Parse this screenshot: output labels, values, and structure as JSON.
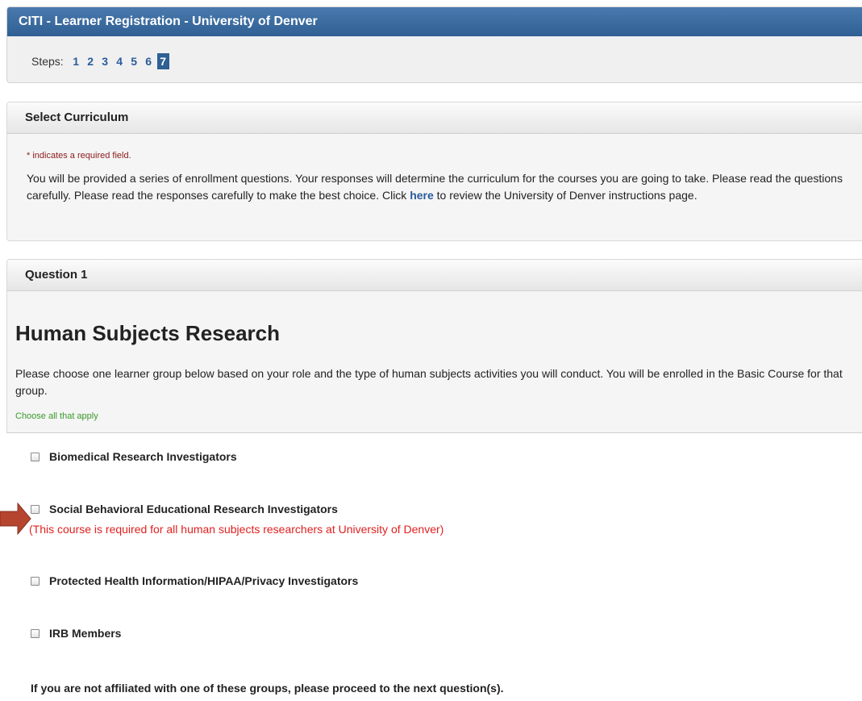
{
  "header": {
    "title": "CITI - Learner Registration - University of Denver",
    "steps_label": "Steps:",
    "steps": [
      "1",
      "2",
      "3",
      "4",
      "5",
      "6",
      "7"
    ],
    "active_step": "7"
  },
  "curriculum": {
    "heading": "Select Curriculum",
    "required_note": "* indicates a required field.",
    "intro_before_link": "You will be provided a series of enrollment questions. Your responses will determine the curriculum for the courses you are going to take. Please read the questions carefully. Please read the responses carefully to make the best choice. Click ",
    "link_text": "here",
    "intro_after_link": " to review the University of Denver instructions page."
  },
  "question": {
    "label": "Question 1",
    "heading": "Human Subjects Research",
    "description": "Please choose one learner group below based on your role and the type of human subjects activities you will conduct. You will be enrolled in the Basic Course for that group.",
    "choose_note": "Choose all that apply",
    "options": [
      {
        "label": "Biomedical Research Investigators"
      },
      {
        "label": "Social Behavioral Educational Research Investigators"
      },
      {
        "label": "Protected Health Information/HIPAA/Privacy Investigators"
      },
      {
        "label": "IRB Members"
      }
    ],
    "required_course_note": "(This course is required for all human subjects researchers at University of Denver)",
    "footer": "If you are not affiliated with one of these groups, please proceed to the next question(s)."
  },
  "colors": {
    "title_bar": "#2f5f93",
    "link": "#2a5b9c",
    "required_red": "#e02020",
    "choose_green": "#3a9a2a",
    "annotation_arrow": "#b5452f"
  },
  "icons": {
    "annotation": "right-arrow-icon"
  }
}
